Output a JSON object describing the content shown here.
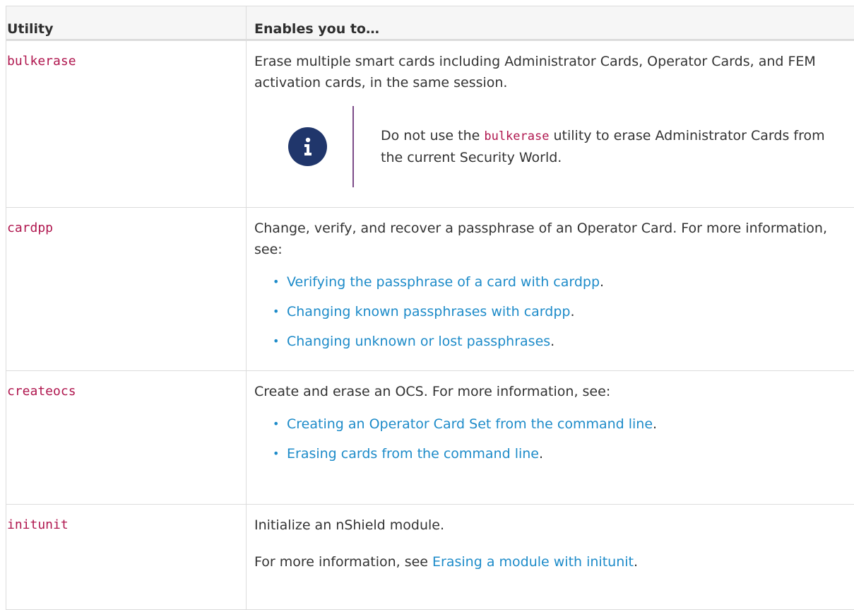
{
  "table": {
    "headers": {
      "utility": "Utility",
      "enables": "Enables you to…"
    },
    "rows": [
      {
        "utility": "bulkerase",
        "description": "Erase multiple smart cards including Administrator Cards, Operator Cards, and FEM activation cards, in the same session.",
        "note": {
          "icon": "info-icon",
          "text_before": "Do not use the ",
          "code": "bulkerase",
          "text_after": " utility to erase Administrator Cards from the current Security World."
        }
      },
      {
        "utility": "cardpp",
        "description": "Change, verify, and recover a passphrase of an Operator Card. For more information, see:",
        "links": [
          "Verifying the passphrase of a card with cardpp",
          "Changing known passphrases with cardpp",
          "Changing unknown or lost passphrases"
        ]
      },
      {
        "utility": "createocs",
        "description": "Create and erase an OCS. For more information, see:",
        "links": [
          "Creating an Operator Card Set from the command line",
          "Erasing cards from the command line"
        ]
      },
      {
        "utility": "initunit",
        "description": "Initialize an nShield module.",
        "more_prefix": "For more information, see ",
        "more_link": "Erasing a module with initunit"
      }
    ],
    "link_suffix": "."
  },
  "colors": {
    "link": "#1d8bc9",
    "code": "#b0174f",
    "note_rule": "#7c4b88",
    "info_icon": "#20366b"
  }
}
